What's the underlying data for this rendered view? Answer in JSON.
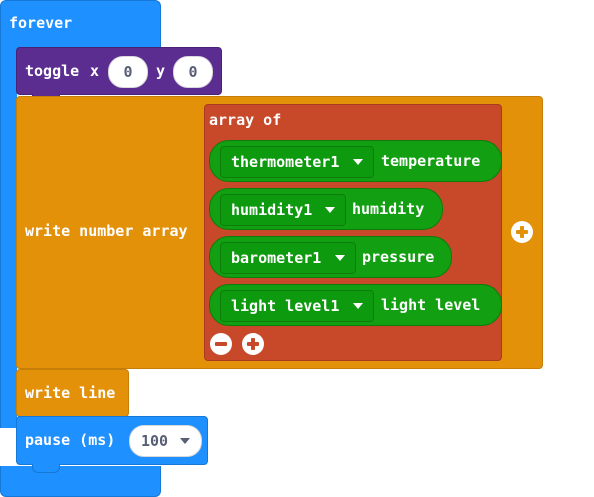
{
  "forever": {
    "label": "forever"
  },
  "toggle": {
    "label": "toggle",
    "x_label": "x",
    "x_value": "0",
    "y_label": "y",
    "y_value": "0"
  },
  "write_number_array": {
    "label": "write number array",
    "array": {
      "label": "array of",
      "items": [
        {
          "sensor": "thermometer1",
          "property": "temperature"
        },
        {
          "sensor": "humidity1",
          "property": "humidity"
        },
        {
          "sensor": "barometer1",
          "property": "pressure"
        },
        {
          "sensor": "light level1",
          "property": "light level"
        }
      ]
    }
  },
  "write_line": {
    "label": "write line"
  },
  "pause": {
    "label": "pause (ms)",
    "value": "100"
  },
  "icons": {
    "dropdown": "caret-down-icon",
    "remove": "minus-circle-icon",
    "add": "plus-circle-icon"
  },
  "colors": {
    "loops": "#1e90ff",
    "purple": "#5c2d91",
    "orange": "#e4910a",
    "array": "#c8482a",
    "sensor": "#12a012"
  }
}
